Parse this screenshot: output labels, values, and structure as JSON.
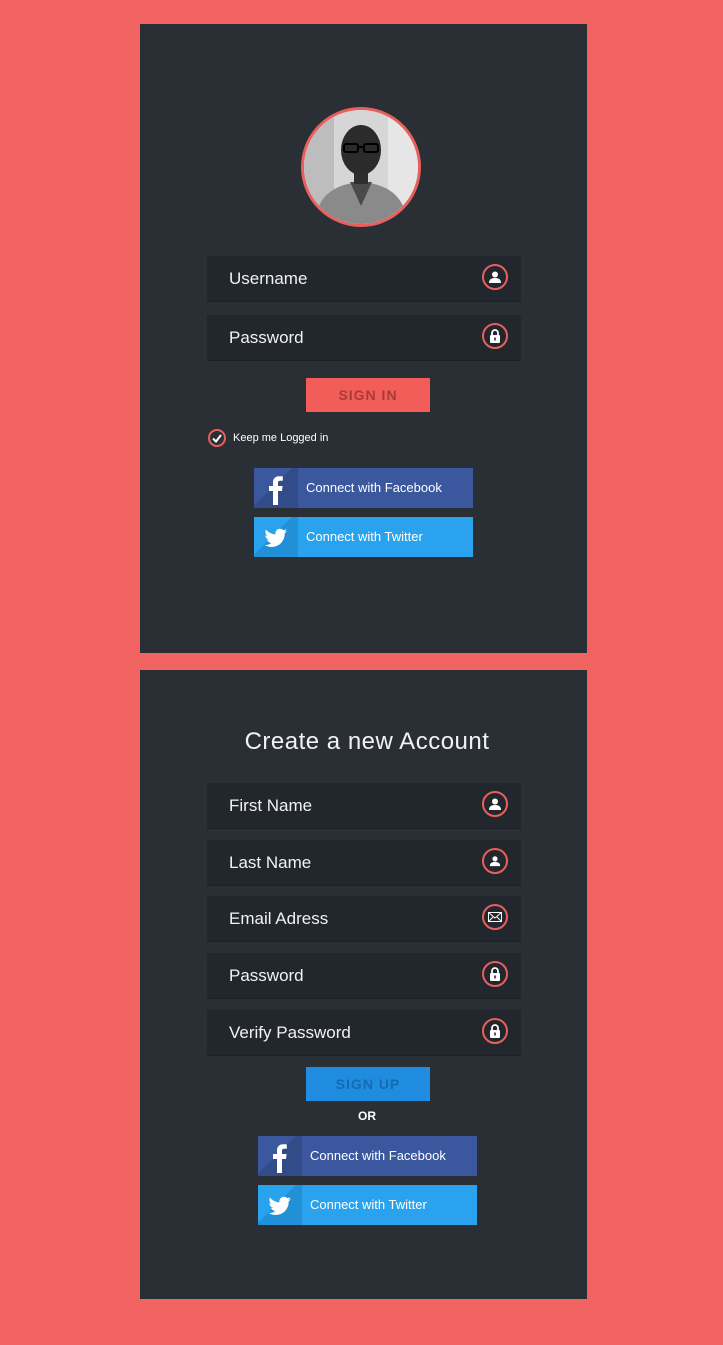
{
  "login": {
    "avatar_alt": "profile photo",
    "fields": [
      {
        "label": "Username",
        "icon": "user-icon"
      },
      {
        "label": "Password",
        "icon": "lock-icon"
      }
    ],
    "signin_label": "SIGN IN",
    "remember_label": "Keep me Logged in",
    "remember_checked": true,
    "facebook_label": "Connect with Facebook",
    "twitter_label": "Connect with Twitter"
  },
  "signup": {
    "title": "Create a new Account",
    "fields": [
      {
        "label": "First Name",
        "icon": "user-icon"
      },
      {
        "label": "Last Name",
        "icon": "user-icon"
      },
      {
        "label": "Email Adress",
        "icon": "mail-icon"
      },
      {
        "label": "Password",
        "icon": "lock-icon"
      },
      {
        "label": "Verify Password",
        "icon": "lock-icon"
      }
    ],
    "signup_label": "SIGN UP",
    "or_label": "OR",
    "facebook_label": "Connect with Facebook",
    "twitter_label": "Connect with Twitter"
  },
  "colors": {
    "background": "#f26461",
    "panel": "#2a2f36",
    "field": "#22262d",
    "accent": "#e8605b",
    "signin": "#f25d5a",
    "signup": "#1f8ce0",
    "facebook": "#3b579d",
    "twitter": "#2aa3ef"
  }
}
